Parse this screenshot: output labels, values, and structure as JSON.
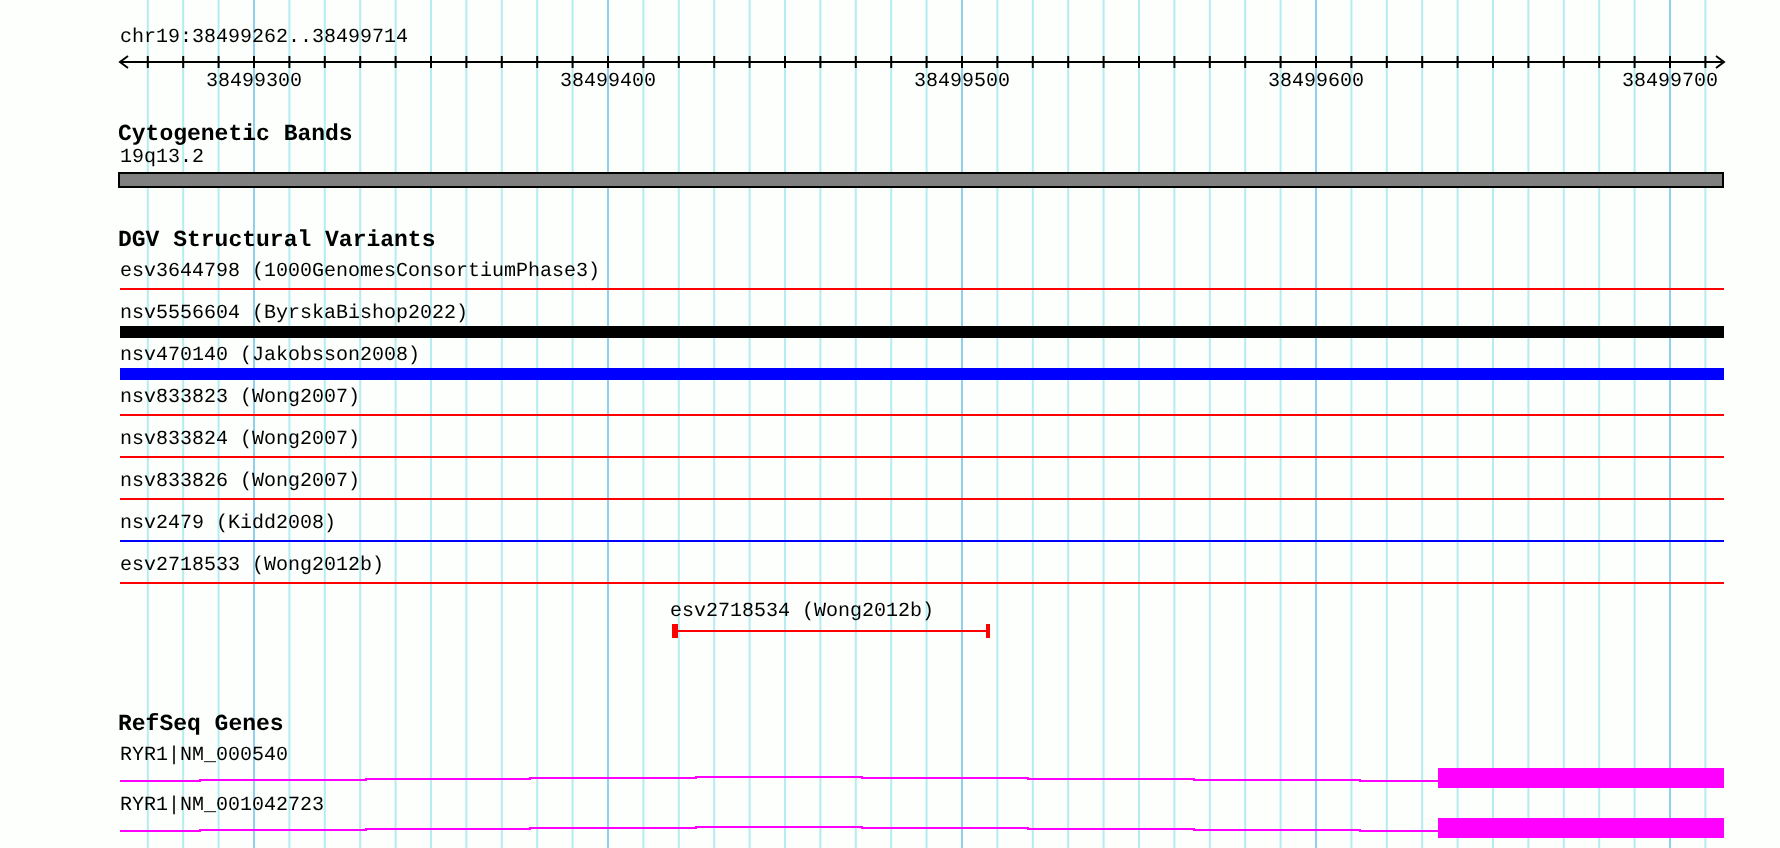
{
  "ruler": {
    "location": "chr19:38499262..38499714",
    "tick_labels": [
      "38499300",
      "38499400",
      "38499500",
      "38499600",
      "38499700"
    ]
  },
  "tracks": [
    {
      "title": "Cytogenetic Bands",
      "kind": "cytoband",
      "features": [
        {
          "label": "19q13.2",
          "kind": "band",
          "color": "#808080"
        }
      ]
    },
    {
      "title": "DGV Structural Variants",
      "kind": "variants",
      "features": [
        {
          "label": "esv3644798 (1000GenomesConsortiumPhase3)",
          "kind": "line",
          "color": "#ff0000"
        },
        {
          "label": "nsv5556604 (ByrskaBishop2022)",
          "kind": "bar",
          "color": "#000000"
        },
        {
          "label": "nsv470140 (Jakobsson2008)",
          "kind": "bar",
          "color": "#0000ff"
        },
        {
          "label": "nsv833823 (Wong2007)",
          "kind": "line",
          "color": "#ff0000"
        },
        {
          "label": "nsv833824 (Wong2007)",
          "kind": "line",
          "color": "#ff0000"
        },
        {
          "label": "nsv833826 (Wong2007)",
          "kind": "line",
          "color": "#ff0000"
        },
        {
          "label": "nsv2479 (Kidd2008)",
          "kind": "line",
          "color": "#0000ff"
        },
        {
          "label": "esv2718533 (Wong2012b)",
          "kind": "line",
          "color": "#ff0000"
        },
        {
          "label": "esv2718534 (Wong2012b)",
          "kind": "interval",
          "color": "#ff0000"
        }
      ]
    },
    {
      "title": "RefSeq Genes",
      "kind": "genes",
      "features": [
        {
          "label": "RYR1|NM_000540",
          "kind": "gene",
          "color": "#ff00ff"
        },
        {
          "label": "RYR1|NM_001042723",
          "kind": "gene",
          "color": "#ff00ff"
        }
      ]
    }
  ]
}
